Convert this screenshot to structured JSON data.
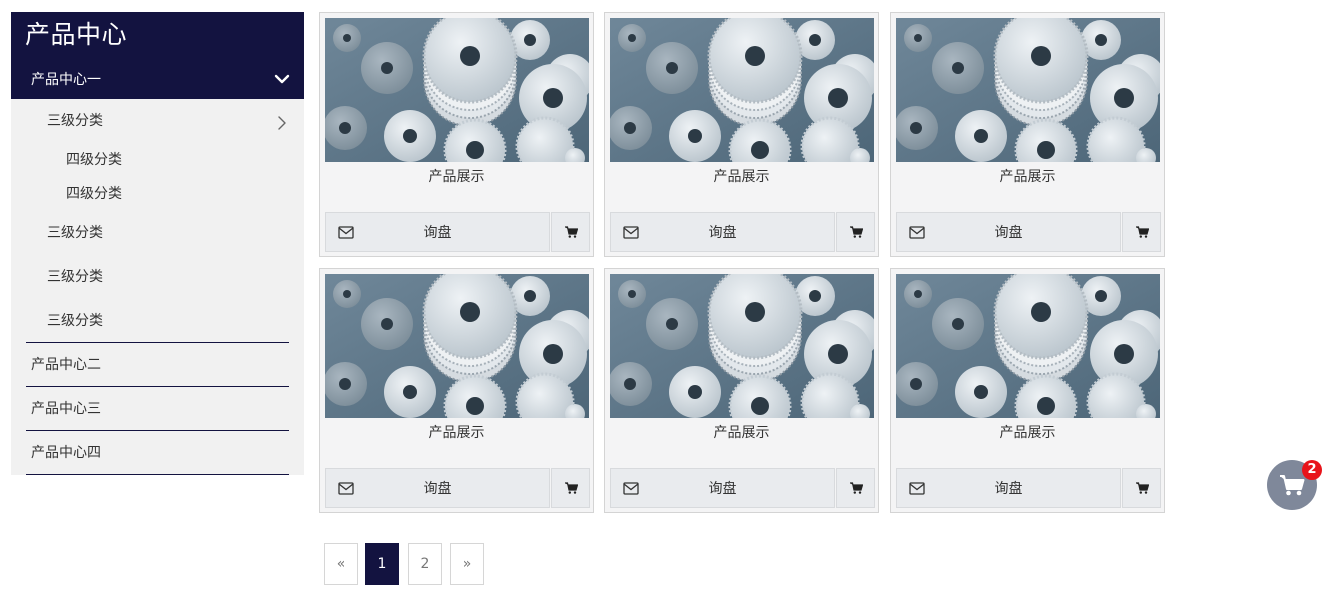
{
  "sidebar": {
    "title": "产品中心",
    "open_category": "产品中心一",
    "level3_expanded": "三级分类",
    "level4_items": [
      "四级分类",
      "四级分类"
    ],
    "level3_items": [
      "三级分类",
      "三级分类",
      "三级分类"
    ],
    "level2_items": [
      "产品中心二",
      "产品中心三",
      "产品中心四"
    ]
  },
  "products": [
    {
      "title": "产品展示",
      "inquire_label": "询盘"
    },
    {
      "title": "产品展示",
      "inquire_label": "询盘"
    },
    {
      "title": "产品展示",
      "inquire_label": "询盘"
    },
    {
      "title": "产品展示",
      "inquire_label": "询盘"
    },
    {
      "title": "产品展示",
      "inquire_label": "询盘"
    },
    {
      "title": "产品展示",
      "inquire_label": "询盘"
    }
  ],
  "pagination": {
    "prev": "«",
    "pages": [
      "1",
      "2"
    ],
    "current": "1",
    "next": "»"
  },
  "floating_cart": {
    "count": "2",
    "icon": "cart-icon"
  },
  "colors": {
    "primary_navy": "#131340",
    "badge_red": "#e8141a",
    "float_cart_bg": "#7f889a"
  }
}
